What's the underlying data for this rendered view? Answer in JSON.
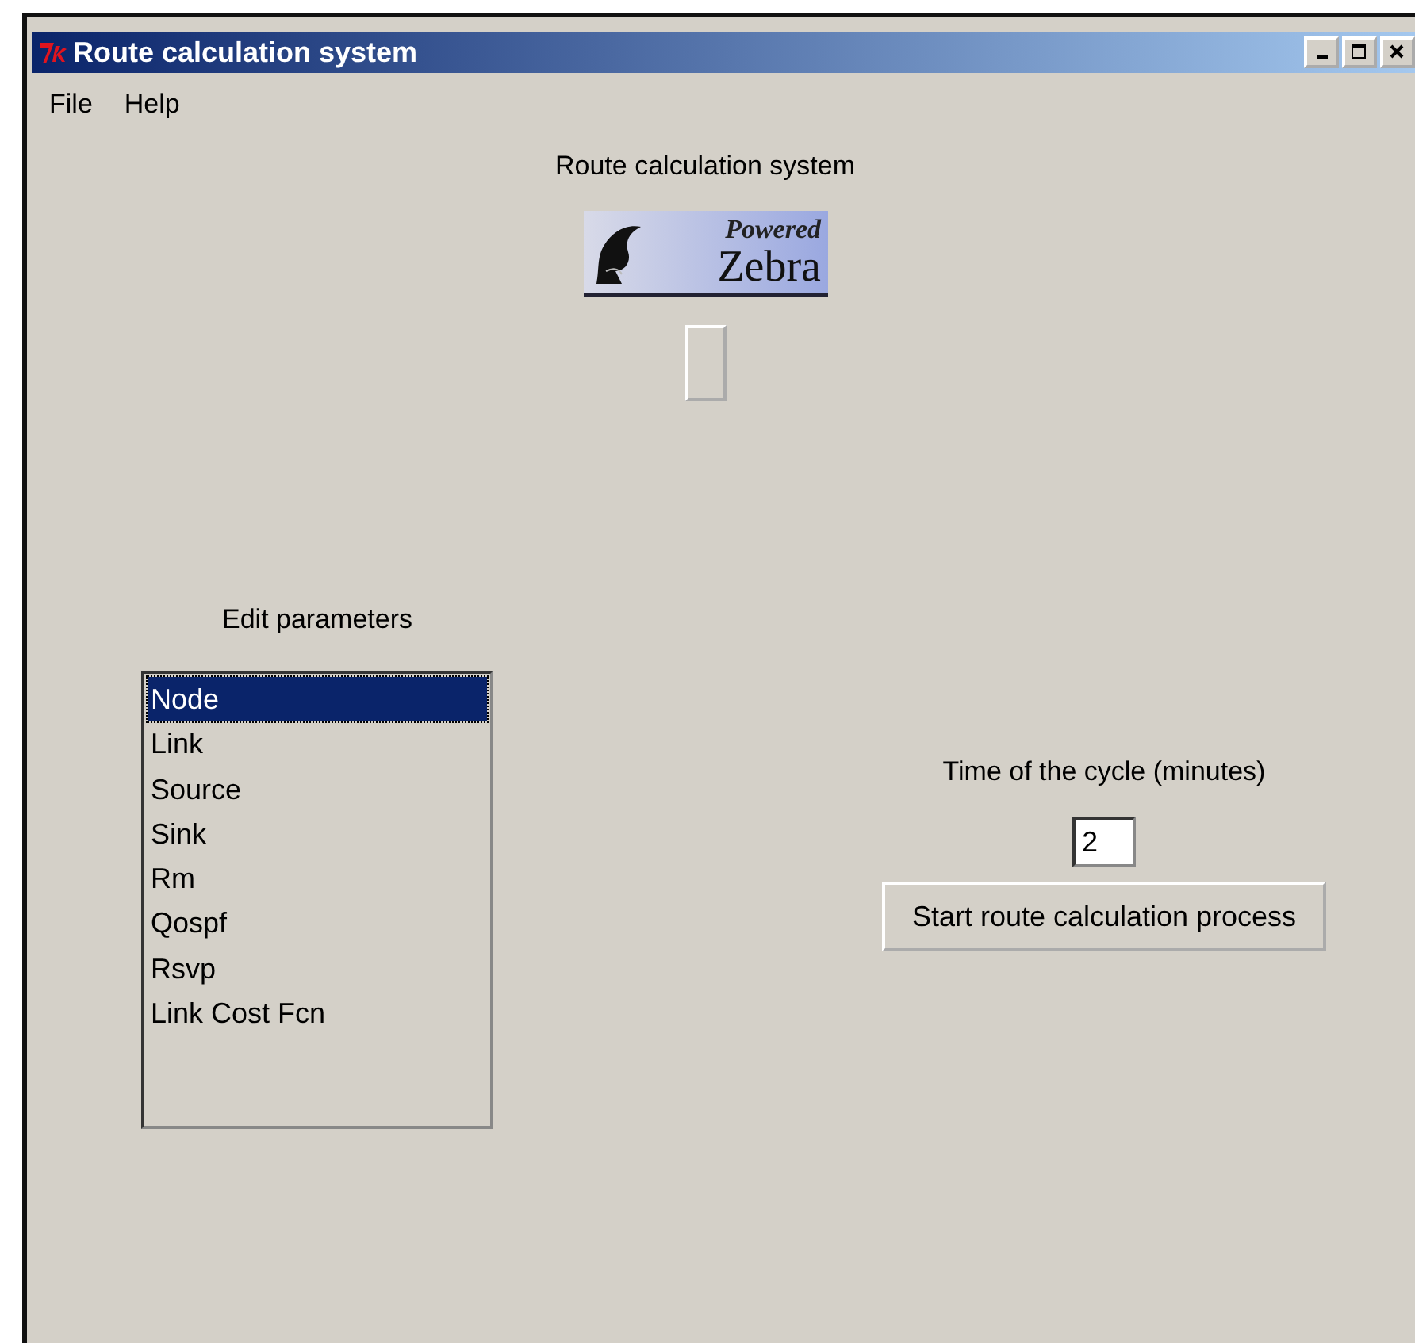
{
  "window": {
    "title": "Route calculation system"
  },
  "menu": [
    "File",
    "Help"
  ],
  "heading": "Route calculation system",
  "logo": {
    "top": "Powered",
    "bottom": "Zebra"
  },
  "parameters": {
    "label": "Edit parameters",
    "items": [
      {
        "label": "Node",
        "selected": true
      },
      {
        "label": "Link",
        "selected": false
      },
      {
        "label": "Source",
        "selected": false
      },
      {
        "label": "Sink",
        "selected": false
      },
      {
        "label": "Rm",
        "selected": false
      },
      {
        "label": "Qospf",
        "selected": false
      },
      {
        "label": "Rsvp",
        "selected": false
      },
      {
        "label": "Link Cost Fcn",
        "selected": false
      }
    ]
  },
  "cycle": {
    "label": "Time of the cycle (minutes)",
    "value": "2"
  },
  "start_button": "Start route calculation process"
}
